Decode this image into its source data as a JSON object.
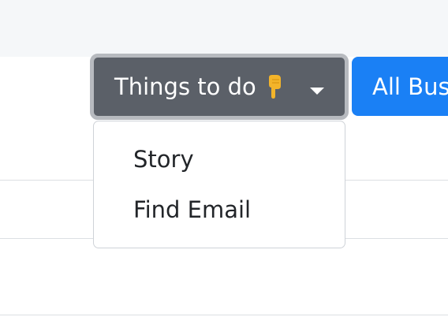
{
  "toolbar": {
    "things_to_do": {
      "label": "Things to do",
      "icon": "pointing-down-hand-icon",
      "caret_icon": "caret-down-icon"
    },
    "all_business_label": "All Bus"
  },
  "dropdown": {
    "items": [
      {
        "label": "Story"
      },
      {
        "label": "Find Email"
      }
    ]
  },
  "colors": {
    "secondary_button": "#5b6068",
    "primary_button": "#1a80f5",
    "emoji_yellow": "#f3b42a"
  }
}
